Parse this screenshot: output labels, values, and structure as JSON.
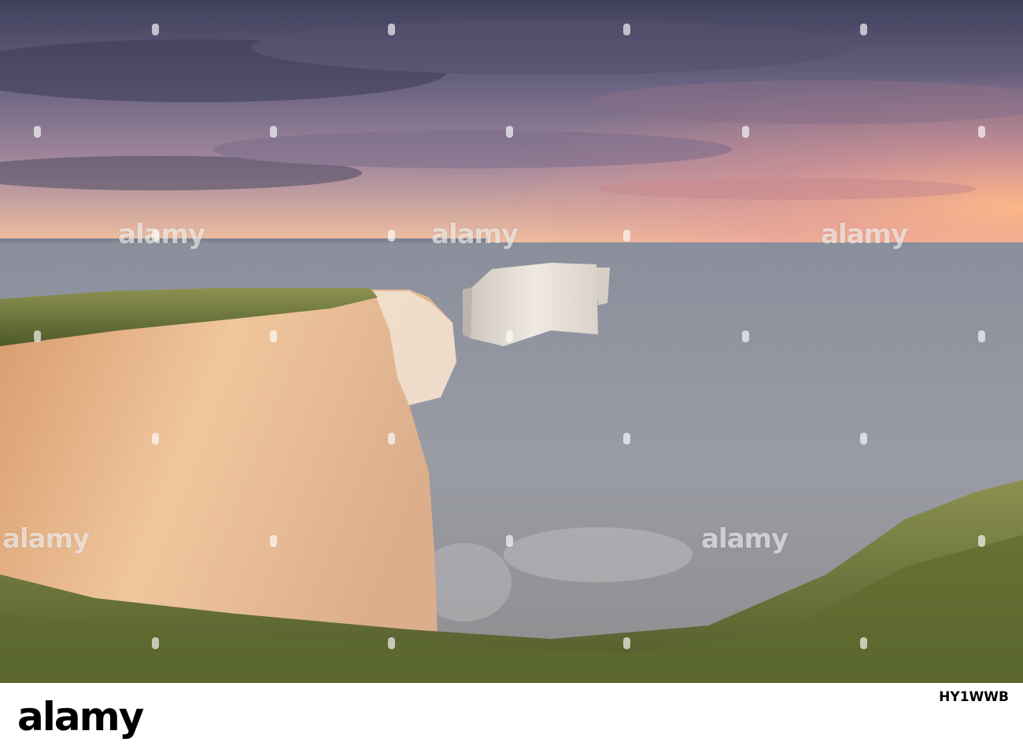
{
  "watermark": {
    "text": "alamy"
  },
  "footer": {
    "logo": "alamy",
    "image_id": "HY1WWB"
  },
  "colors": {
    "sky_top": "#4d4e6e",
    "sky_horizon": "#f4b590",
    "sea": "#9a9ea6",
    "cliff_lit": "#e9b68a",
    "chalk_stack": "#e8e2da",
    "grass": "#6f7a3c"
  }
}
